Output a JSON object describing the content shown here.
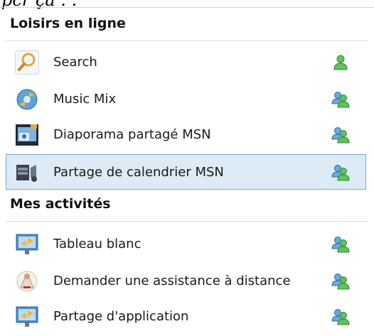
{
  "top_fragment": "pcr ça . .",
  "sections": [
    {
      "title": "Loisirs en ligne",
      "items": [
        {
          "label": "Search",
          "app_icon": "search-icon",
          "people_icon": "single-person-icon",
          "selected": false
        },
        {
          "label": "Music Mix",
          "app_icon": "music-mix-icon",
          "people_icon": "two-people-icon",
          "selected": false
        },
        {
          "label": "Diaporama partagé MSN",
          "app_icon": "slideshow-icon",
          "people_icon": "two-people-icon",
          "selected": false
        },
        {
          "label": "Partage de calendrier MSN",
          "app_icon": "calendar-share-icon",
          "people_icon": "two-people-icon",
          "selected": true
        }
      ]
    },
    {
      "title": "Mes activités",
      "items": [
        {
          "label": "Tableau blanc",
          "app_icon": "whiteboard-icon",
          "people_icon": "two-people-icon",
          "selected": false
        },
        {
          "label": "Demander une assistance à distance",
          "app_icon": "remote-assistance-icon",
          "people_icon": "two-people-icon",
          "selected": false
        },
        {
          "label": "Partage d'application",
          "app_icon": "application-share-icon",
          "people_icon": "two-people-icon",
          "selected": false
        }
      ]
    }
  ],
  "colors": {
    "selection_bg": "#dcebf6",
    "selection_border": "#7ea6c8",
    "person_green": "#3fae3f",
    "person_blue": "#4a90c8"
  }
}
